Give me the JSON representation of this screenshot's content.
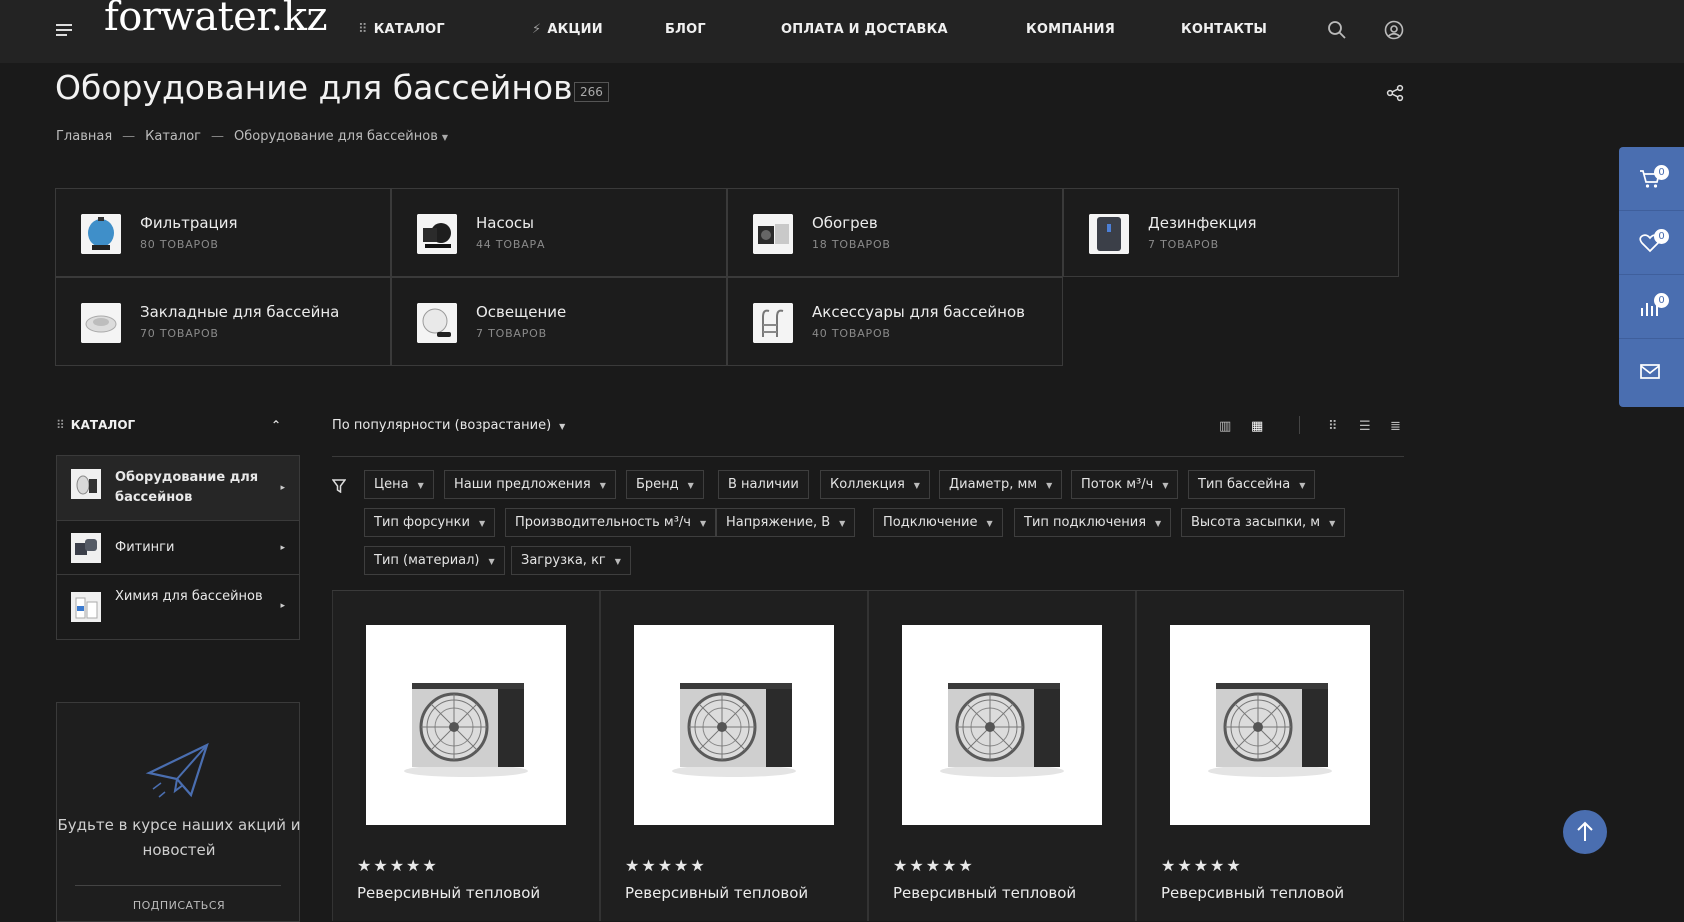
{
  "header": {
    "logo": "forwater.kz",
    "nav": [
      {
        "label": "КАТАЛОГ",
        "icon": "grid-icon"
      },
      {
        "label": "АКЦИИ",
        "icon": "lightning-icon"
      },
      {
        "label": "БЛОГ"
      },
      {
        "label": "ОПЛАТА И ДОСТАВКА"
      },
      {
        "label": "КОМПАНИЯ"
      },
      {
        "label": "КОНТАКТЫ"
      }
    ]
  },
  "page": {
    "title": "Оборудование для бассейнов",
    "count": "266",
    "breadcrumb": [
      "Главная",
      "Каталог",
      "Оборудование для бассейнов"
    ]
  },
  "categories": [
    {
      "name": "Фильтрация",
      "count": "80 ТОВАРОВ"
    },
    {
      "name": "Насосы",
      "count": "44 ТОВАРА"
    },
    {
      "name": "Обогрев",
      "count": "18 ТОВАРОВ"
    },
    {
      "name": "Дезинфекция",
      "count": "7 ТОВАРОВ"
    },
    {
      "name": "Закладные для бассейна",
      "count": "70 ТОВАРОВ"
    },
    {
      "name": "Освещение",
      "count": "7 ТОВАРОВ"
    },
    {
      "name": "Аксессуары для бассейнов",
      "count": "40 ТОВАРОВ"
    }
  ],
  "sidebar": {
    "title": "КАТАЛОГ",
    "items": [
      {
        "label": "Оборудование для бассейнов",
        "active": true
      },
      {
        "label": "Фитинги",
        "active": false
      },
      {
        "label": "Химия для бассейнов",
        "active": false
      }
    ],
    "subscribe_text": "Будьте в курсе наших акций и новостей",
    "subscribe_button": "ПОДПИСАТЬСЯ"
  },
  "toolbar": {
    "sort_label": "По популярности (возрастание)"
  },
  "filters": [
    "Цена",
    "Наши предложения",
    "Бренд",
    "В наличии",
    "Коллекция",
    "Диаметр, мм",
    "Поток м³/ч",
    "Тип бассейна",
    "Тип форсунки",
    "Производительность м³/ч",
    "Напряжение, В",
    "Подключение",
    "Тип подключения",
    "Высота засыпки, м",
    "Тип (материал)",
    "Загрузка, кг"
  ],
  "products": [
    {
      "name": "Реверсивный тепловой",
      "stars": "★★★★★"
    },
    {
      "name": "Реверсивный тепловой",
      "stars": "★★★★★"
    },
    {
      "name": "Реверсивный тепловой",
      "stars": "★★★★★"
    },
    {
      "name": "Реверсивный тепловой",
      "stars": "★★★★★"
    }
  ],
  "widget": {
    "cart_count": "0",
    "favorites_count": "0",
    "compare_count": "0"
  },
  "colors": {
    "background": "#1a1a1a",
    "header": "#232323",
    "accent": "#4a6eb0"
  }
}
